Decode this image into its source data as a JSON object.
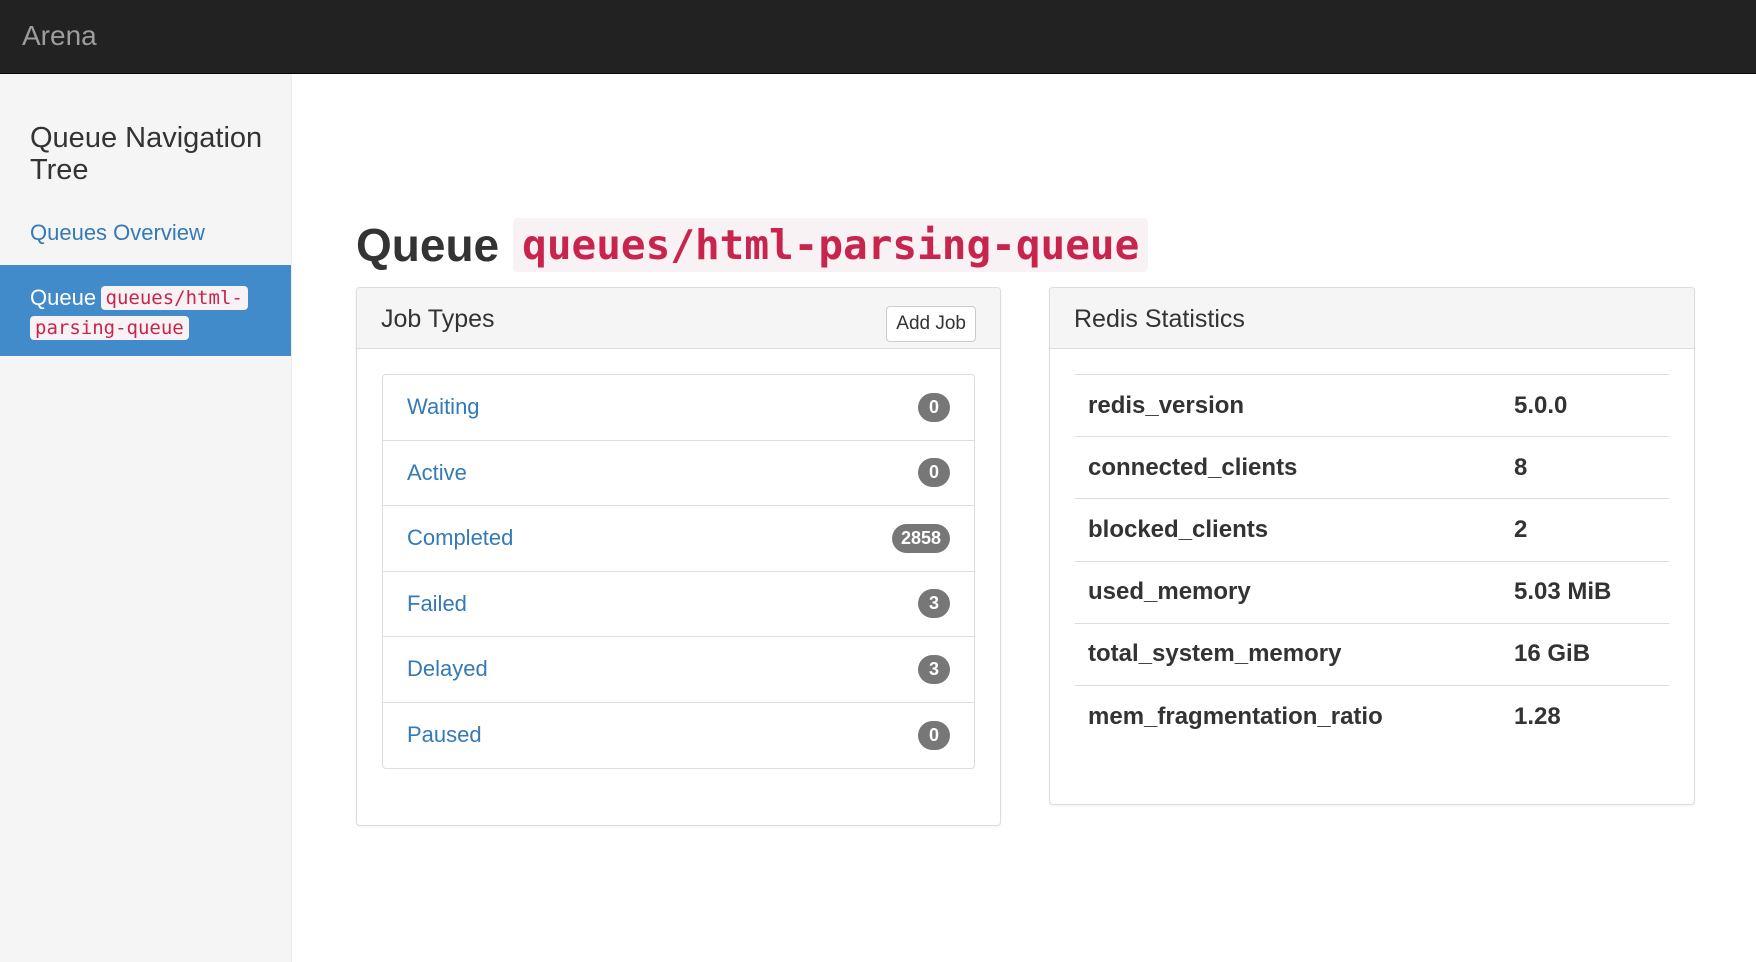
{
  "navbar": {
    "brand": "Arena"
  },
  "sidebar": {
    "title": "Queue Navigation Tree",
    "overview_link": "Queues Overview",
    "active_item": {
      "prefix": "Queue",
      "name_line1": "queues/html-",
      "name_line2": "parsing-queue"
    }
  },
  "page": {
    "heading_label": "Queue",
    "queue_name": "queues/html-parsing-queue"
  },
  "job_types": {
    "title": "Job Types",
    "add_job_label": "Add Job",
    "items": [
      {
        "label": "Waiting",
        "count": "0"
      },
      {
        "label": "Active",
        "count": "0"
      },
      {
        "label": "Completed",
        "count": "2858"
      },
      {
        "label": "Failed",
        "count": "3"
      },
      {
        "label": "Delayed",
        "count": "3"
      },
      {
        "label": "Paused",
        "count": "0"
      }
    ]
  },
  "redis_stats": {
    "title": "Redis Statistics",
    "rows": [
      {
        "key": "redis_version",
        "value": "5.0.0"
      },
      {
        "key": "connected_clients",
        "value": "8"
      },
      {
        "key": "blocked_clients",
        "value": "2"
      },
      {
        "key": "used_memory",
        "value": "5.03 MiB"
      },
      {
        "key": "total_system_memory",
        "value": "16 GiB"
      },
      {
        "key": "mem_fragmentation_ratio",
        "value": "1.28"
      }
    ]
  },
  "colors": {
    "navbar_bg": "#222222",
    "link": "#337ab7",
    "active_bg": "#428bca",
    "code_text": "#c7254e",
    "code_bg": "#f9f2f4",
    "badge_bg": "#777777"
  }
}
